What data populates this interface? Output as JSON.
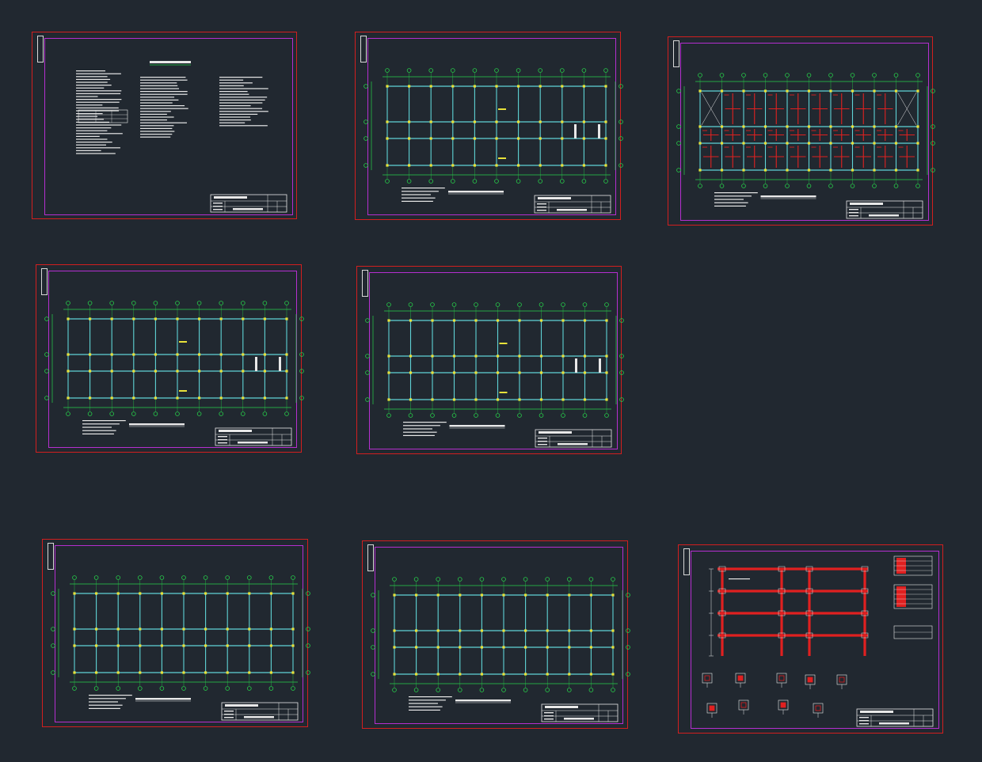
{
  "workspace": {
    "background": "#212830"
  },
  "colors": {
    "sheet_border": "#d21f1f",
    "inner_frame": "#b52fd0",
    "axis_grid": "#27d04a",
    "beams": "#5fd3d6",
    "columns": "#e8e23a",
    "rebar": "#e02020",
    "text": "#e8e8e8"
  },
  "sheets": [
    {
      "id": "sheet-1",
      "kind": "notes"
    },
    {
      "id": "sheet-2",
      "kind": "plan",
      "variant": "yellow"
    },
    {
      "id": "sheet-3",
      "kind": "plan",
      "variant": "red"
    },
    {
      "id": "sheet-4",
      "kind": "plan",
      "variant": "yellow"
    },
    {
      "id": "sheet-5",
      "kind": "plan",
      "variant": "yellow"
    },
    {
      "id": "sheet-6",
      "kind": "plan",
      "variant": "plain"
    },
    {
      "id": "sheet-7",
      "kind": "plan",
      "variant": "plain"
    },
    {
      "id": "sheet-8",
      "kind": "frame"
    }
  ]
}
